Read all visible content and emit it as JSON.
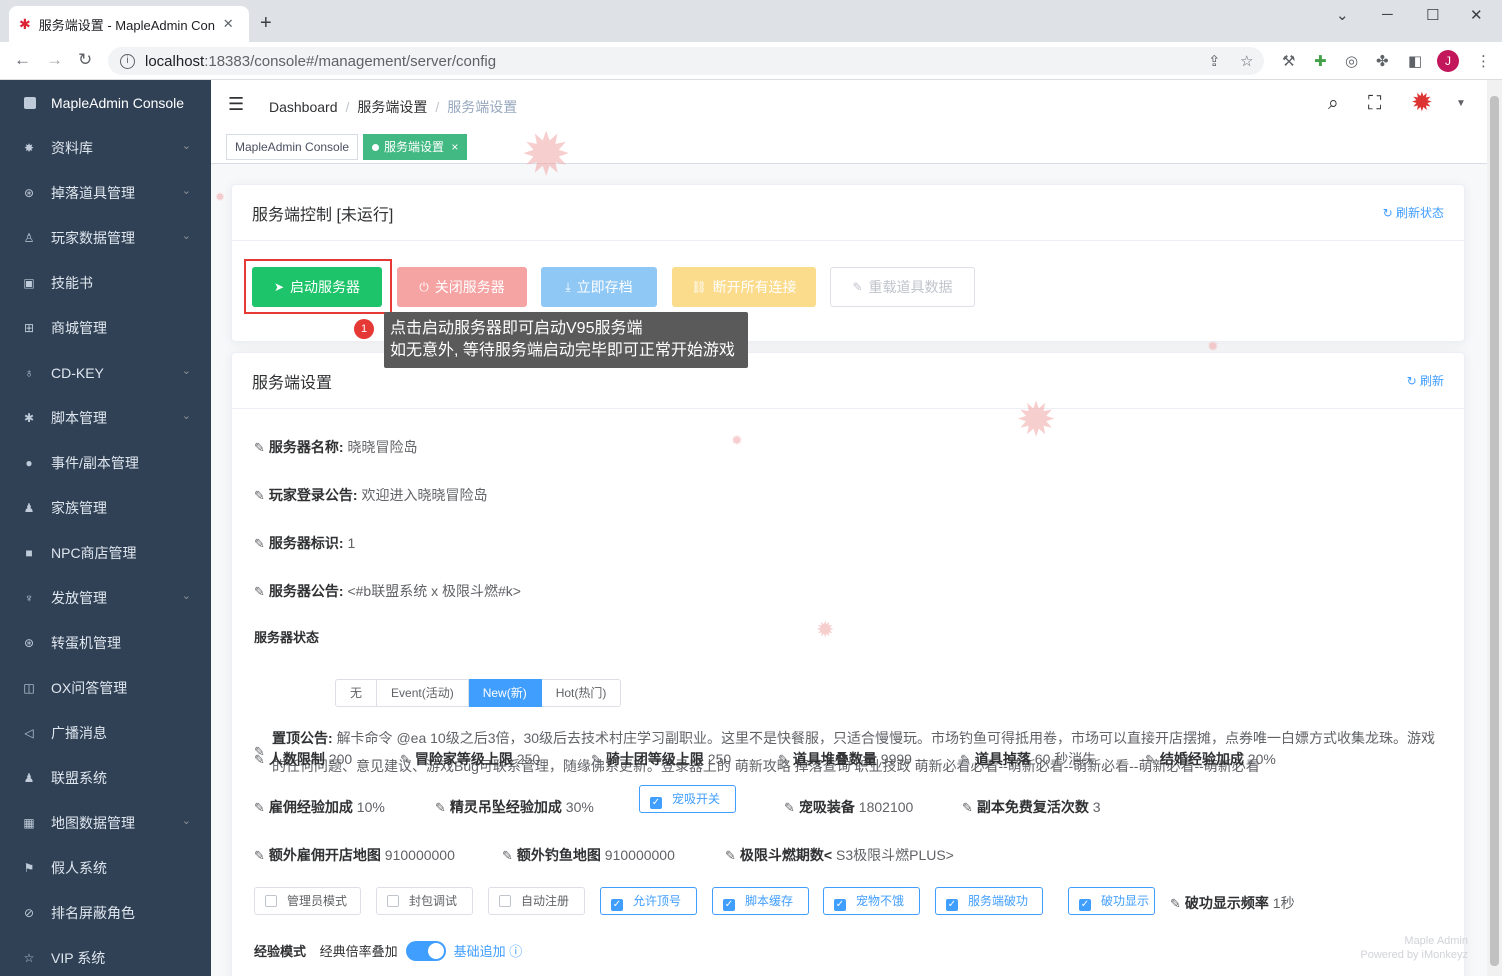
{
  "browser": {
    "tab_title": "服务端设置 - MapleAdmin Con",
    "new_tab": "+",
    "url_host": "localhost",
    "url_rest": ":18383/console#/management/server/config",
    "avatar_letter": "J"
  },
  "sidebar": {
    "title": "MapleAdmin Console",
    "items": [
      {
        "label": "资料库",
        "icon": "✸",
        "chev": "⌄"
      },
      {
        "label": "掉落道具管理",
        "icon": "⊛",
        "chev": "⌄"
      },
      {
        "label": "玩家数据管理",
        "icon": "♙",
        "chev": "⌄"
      },
      {
        "label": "技能书",
        "icon": "▣",
        "chev": ""
      },
      {
        "label": "商城管理",
        "icon": "⊞",
        "chev": ""
      },
      {
        "label": "CD-KEY",
        "icon": "♁",
        "chev": "⌄"
      },
      {
        "label": "脚本管理",
        "icon": "✱",
        "chev": "⌄"
      },
      {
        "label": "事件/副本管理",
        "icon": "●",
        "chev": ""
      },
      {
        "label": "家族管理",
        "icon": "♟",
        "chev": ""
      },
      {
        "label": "NPC商店管理",
        "icon": "■",
        "chev": ""
      },
      {
        "label": "发放管理",
        "icon": "♆",
        "chev": "⌄"
      },
      {
        "label": "转蛋机管理",
        "icon": "⊛",
        "chev": ""
      },
      {
        "label": "OX问答管理",
        "icon": "◫",
        "chev": ""
      },
      {
        "label": "广播消息",
        "icon": "◁",
        "chev": ""
      },
      {
        "label": "联盟系统",
        "icon": "♟",
        "chev": ""
      },
      {
        "label": "地图数据管理",
        "icon": "▦",
        "chev": "⌄"
      },
      {
        "label": "假人系统",
        "icon": "⚑",
        "chev": ""
      },
      {
        "label": "排名屏蔽角色",
        "icon": "⊘",
        "chev": ""
      },
      {
        "label": "VIP 系统",
        "icon": "☆",
        "chev": ""
      }
    ]
  },
  "breadcrumb": {
    "items": [
      "Dashboard",
      "服务端设置",
      "服务端设置"
    ],
    "sep": "/"
  },
  "tags": {
    "first": "MapleAdmin Console",
    "active": "服务端设置",
    "close": "×"
  },
  "control": {
    "title": "服务端控制 [未运行]",
    "refresh": "刷新状态",
    "buttons": [
      {
        "label": "启动服务器",
        "icon": "➤",
        "color": "#1ec46a"
      },
      {
        "label": "关闭服务器",
        "icon": "⏻",
        "color": "#f6a3a3"
      },
      {
        "label": "立即存档",
        "icon": "⤓",
        "color": "#8fc7f5"
      },
      {
        "label": "断开所有连接",
        "icon": "⛓",
        "color": "#fbdb8c"
      },
      {
        "label": "重载道具数据",
        "icon": "✎",
        "color": "#ffffff"
      }
    ],
    "tip_num": "1",
    "tip_line1": "点击启动服务器即可启动V95服务端",
    "tip_line2": "如无意外, 等待服务端启动完毕即可正常开始游戏"
  },
  "settings": {
    "title": "服务端设置",
    "refresh": "刷新",
    "server_name_label": "服务器名称:",
    "server_name": "晓晓冒险岛",
    "login_notice_label": "玩家登录公告:",
    "login_notice": "欢迎进入晓晓冒险岛",
    "server_id_label": "服务器标识:",
    "server_id": "1",
    "server_notice_label": "服务器公告:",
    "server_notice": "<#b联盟系统 x 极限斗燃#k>",
    "status_label": "服务器状态",
    "status_options": [
      "无",
      "Event(活动)",
      "New(新)",
      "Hot(热门)"
    ],
    "status_selected": "New(新)",
    "top_notice_label": "置顶公告:",
    "top_notice_line1": "解卡命令 @ea 10级之后3倍，30级后去技术村庄学习副职业。这里不是快餐服，只适合慢慢玩。市场钓鱼可得抵用卷，市场可以直接开店摆摊，点券唯一白嫖方式收集龙珠。游戏",
    "top_notice_line2": "的任何问题、意见建议、游戏Bug可联系管理，随缘佛系更新。登录器上的 萌新攻略 掉落查询 职业技政 萌新必看必看--萌新必看--萌新必看--萌新必看--萌新必看",
    "row1": [
      {
        "label": "人数限制",
        "value": "200"
      },
      {
        "label": "冒险家等级上限",
        "value": "250"
      },
      {
        "label": "骑士团等级上限",
        "value": "250"
      },
      {
        "label": "道具堆叠数量",
        "value": "9999"
      },
      {
        "label": "道具掉落",
        "value": "60 秒消失"
      },
      {
        "label": "结婚经验加成",
        "value": "20%"
      }
    ],
    "row2": [
      {
        "label": "雇佣经验加成",
        "value": "10%"
      },
      {
        "label": "精灵吊坠经验加成",
        "value": "30%"
      },
      {
        "label": "宠吸开关",
        "value": ""
      },
      {
        "label": "宠吸装备",
        "value": "1802100"
      },
      {
        "label": "副本免费复活次数",
        "value": "3"
      }
    ],
    "row3": [
      {
        "label": "额外雇佣开店地图",
        "value": "910000000"
      },
      {
        "label": "额外钓鱼地图",
        "value": "910000000"
      },
      {
        "label": "极限斗燃期数<",
        "value": "S3极限斗燃PLUS>"
      }
    ],
    "checks": [
      {
        "label": "管理员模式",
        "checked": false
      },
      {
        "label": "封包调试",
        "checked": false
      },
      {
        "label": "自动注册",
        "checked": false
      },
      {
        "label": "允许顶号",
        "checked": true
      },
      {
        "label": "脚本缓存",
        "checked": true
      },
      {
        "label": "宠物不饿",
        "checked": true
      },
      {
        "label": "服务端破功",
        "checked": true
      },
      {
        "label": "破功显示",
        "checked": true
      }
    ],
    "break_freq_label": "破功显示频率",
    "break_freq": "1秒",
    "exp_mode_label": "经验模式",
    "exp_mode_left": "经典倍率叠加",
    "exp_mode_right": "基础追加",
    "exp_mode_on": true
  },
  "watermark": {
    "line1": "Maple Admin",
    "line2": "Powered by iMonkeyz"
  }
}
